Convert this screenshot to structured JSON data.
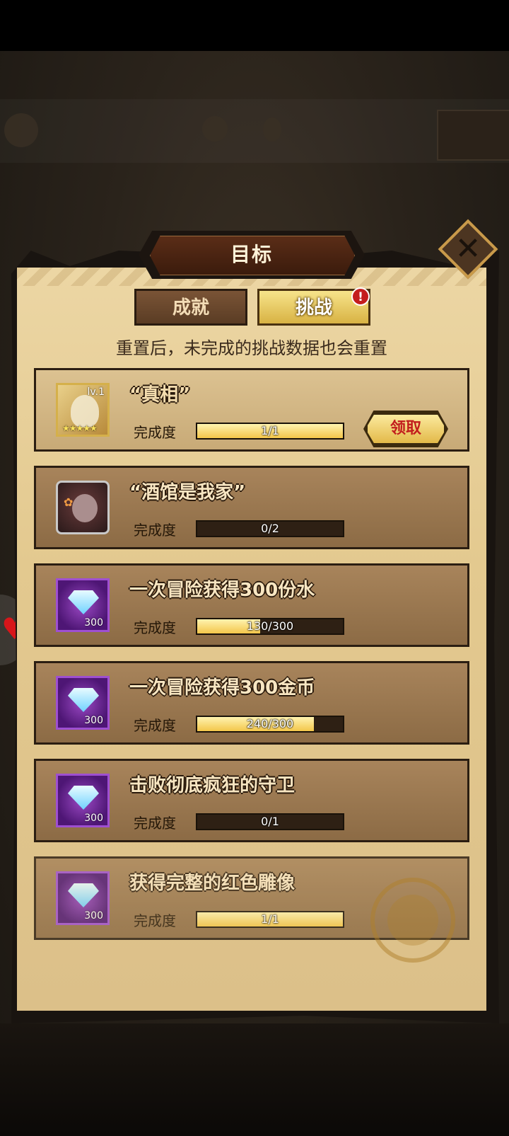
{
  "dialog": {
    "title": "目标",
    "tabs": [
      {
        "label": "成就",
        "active": false
      },
      {
        "label": "挑战",
        "active": true,
        "badge": "!"
      }
    ],
    "notice": "重置后，未完成的挑战数据也会重置",
    "progress_label": "完成度",
    "claim_label": "领取",
    "close_label": "✕"
  },
  "challenges": [
    {
      "title": "“真相”",
      "reward": {
        "type": "hero",
        "level": "lv.1",
        "stars": "★★★★★"
      },
      "progress_text": "1/1",
      "progress": 1.0,
      "claimable": true
    },
    {
      "title": "“酒馆是我家”",
      "reward": {
        "type": "hero"
      },
      "progress_text": "0/2",
      "progress": 0.0,
      "claimable": false
    },
    {
      "title": "一次冒险获得300份水",
      "reward": {
        "type": "diamond",
        "count": "300"
      },
      "progress_text": "130/300",
      "progress": 0.4333,
      "claimable": false
    },
    {
      "title": "一次冒险获得300金币",
      "reward": {
        "type": "diamond",
        "count": "300"
      },
      "progress_text": "240/300",
      "progress": 0.8,
      "claimable": false
    },
    {
      "title": "击败彻底疯狂的守卫",
      "reward": {
        "type": "diamond",
        "count": "300"
      },
      "progress_text": "0/1",
      "progress": 0.0,
      "claimable": false
    },
    {
      "title": "获得完整的红色雕像",
      "reward": {
        "type": "diamond",
        "count": "300"
      },
      "progress_text": "1/1",
      "progress": 1.0,
      "claimable": false
    }
  ],
  "icons": {
    "close": "close-icon",
    "diamond": "diamond-icon",
    "heart": "heart-icon"
  },
  "colors": {
    "accent": "#f3c64a",
    "claim_text": "#c21d1d",
    "badge": "#c41d1d"
  }
}
